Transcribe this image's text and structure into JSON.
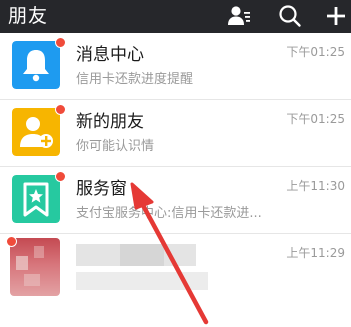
{
  "header": {
    "title": "朋友",
    "icons": [
      "contacts-icon",
      "search-icon",
      "plus-icon"
    ]
  },
  "list": [
    {
      "title": "消息中心",
      "subtitle": "信用卡还款进度提醒",
      "time": "下午01:25",
      "icon": "bell-icon",
      "color": "#1e9bf0",
      "unread": true
    },
    {
      "title": "新的朋友",
      "subtitle": "你可能认识情",
      "time": "下午01:25",
      "icon": "add-friend-icon",
      "color": "#f7b500",
      "unread": true
    },
    {
      "title": "服务窗",
      "subtitle": "支付宝服务中心:信用卡还款进...",
      "time": "上午11:30",
      "icon": "star-bookmark-icon",
      "color": "#26c9a0",
      "unread": true
    },
    {
      "title": "",
      "subtitle": "",
      "time": "上午11:29",
      "icon": "blurred-avatar",
      "color": "#c44a52",
      "unread": true
    }
  ],
  "colors": {
    "header_bg": "#26272b",
    "unread_dot": "#f04b3a",
    "arrow": "#e53935"
  }
}
